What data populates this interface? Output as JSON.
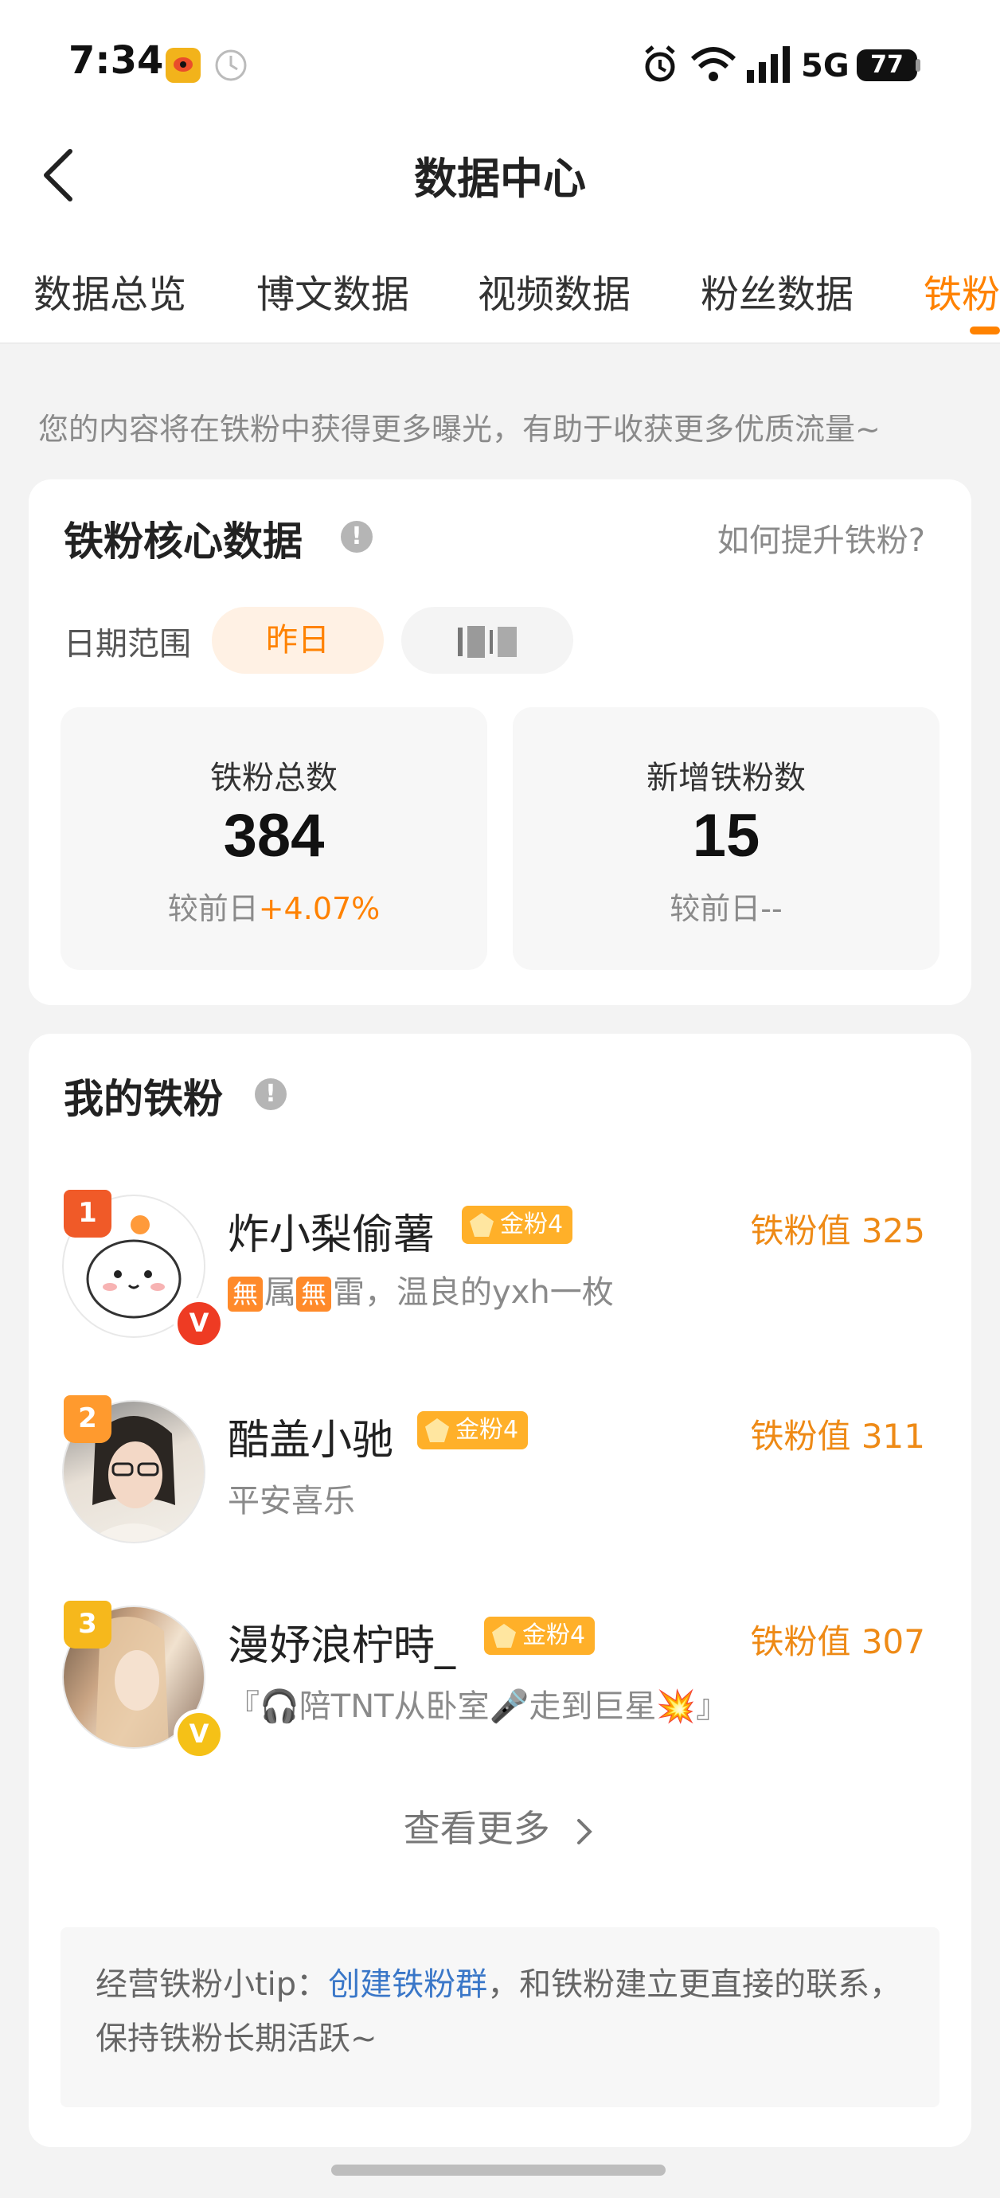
{
  "status_bar": {
    "time": "7:34",
    "network": "5G",
    "battery": "77"
  },
  "header": {
    "title": "数据中心"
  },
  "tabs": [
    {
      "label": "数据总览",
      "active": false
    },
    {
      "label": "博文数据",
      "active": false
    },
    {
      "label": "视频数据",
      "active": false
    },
    {
      "label": "粉丝数据",
      "active": false
    },
    {
      "label": "铁粉",
      "active": true
    }
  ],
  "hint": "您的内容将在铁粉中获得更多曝光，有助于收获更多优质流量~",
  "core": {
    "title": "铁粉核心数据",
    "how_link": "如何提升铁粉?",
    "date_label": "日期范围",
    "date_options": [
      "昨日"
    ],
    "stats": [
      {
        "label": "铁粉总数",
        "value": "384",
        "compare_prefix": "较前日",
        "compare_value": "+4.07%"
      },
      {
        "label": "新增铁粉数",
        "value": "15",
        "compare_prefix": "较前日",
        "compare_value": "--"
      }
    ]
  },
  "my_fans": {
    "title": "我的铁粉",
    "list": [
      {
        "rank": "1",
        "name": "炸小梨偷薯",
        "badge": "金粉4",
        "desc_mid": "属",
        "desc_mid2": "雷，温良的yxh一枚",
        "score": "铁粉值 325"
      },
      {
        "rank": "2",
        "name": "酷盖小驰",
        "badge": "金粉4",
        "desc": "平安喜乐",
        "score": "铁粉值 311"
      },
      {
        "rank": "3",
        "name": "漫妤浪柠時_",
        "badge": "金粉4",
        "desc": "『🎧陪TNT从卧室🎤走到巨星💥』",
        "score": "铁粉值 307"
      }
    ],
    "see_more": "查看更多",
    "tip_prefix": "经营铁粉小tip：",
    "tip_link": "创建铁粉群",
    "tip_suffix": "，和铁粉建立更直接的联系，保持铁粉长期活跃~"
  },
  "colors": {
    "accent": "#ff8200",
    "link": "#3a77c8",
    "background": "#f3f3f3"
  }
}
